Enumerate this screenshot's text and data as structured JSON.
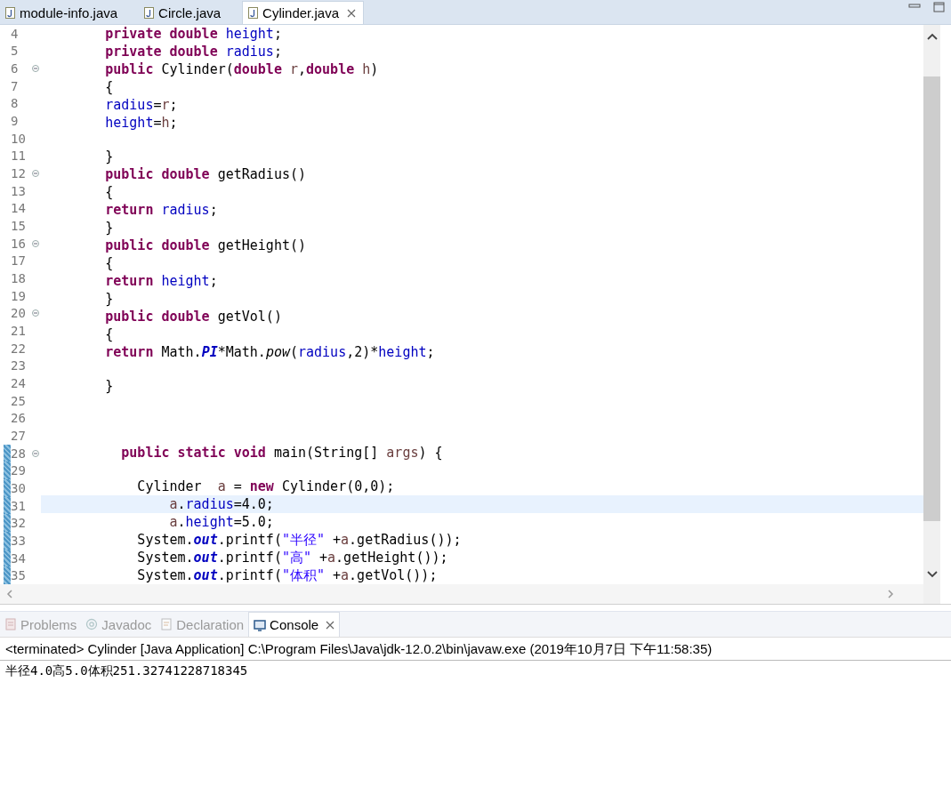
{
  "editor_tabs": [
    {
      "label": "module-info.java",
      "selected": false
    },
    {
      "label": "Circle.java",
      "selected": false
    },
    {
      "label": "Cylinder.java",
      "selected": true,
      "closable": true
    }
  ],
  "code_lines": [
    {
      "number": "4",
      "tokens": [
        {
          "kind": "keyword",
          "text": "        private double "
        },
        {
          "kind": "field",
          "text": "height"
        },
        {
          "kind": "plain",
          "text": ";"
        }
      ]
    },
    {
      "number": "5",
      "tokens": [
        {
          "kind": "keyword",
          "text": "        private double "
        },
        {
          "kind": "field",
          "text": "radius"
        },
        {
          "kind": "plain",
          "text": ";"
        }
      ]
    },
    {
      "number": "6",
      "fold": true,
      "tokens": [
        {
          "kind": "keyword",
          "text": "        public"
        },
        {
          "kind": "plain",
          "text": " Cylinder("
        },
        {
          "kind": "keyword",
          "text": "double "
        },
        {
          "kind": "param",
          "text": "r"
        },
        {
          "kind": "plain",
          "text": ","
        },
        {
          "kind": "keyword",
          "text": "double "
        },
        {
          "kind": "param",
          "text": "h"
        },
        {
          "kind": "plain",
          "text": ")"
        }
      ]
    },
    {
      "number": "7",
      "tokens": [
        {
          "kind": "plain",
          "text": "        {"
        }
      ]
    },
    {
      "number": "8",
      "tokens": [
        {
          "kind": "field",
          "text": "        radius"
        },
        {
          "kind": "plain",
          "text": "="
        },
        {
          "kind": "param",
          "text": "r"
        },
        {
          "kind": "plain",
          "text": ";"
        }
      ]
    },
    {
      "number": "9",
      "tokens": [
        {
          "kind": "field",
          "text": "        height"
        },
        {
          "kind": "plain",
          "text": "="
        },
        {
          "kind": "param",
          "text": "h"
        },
        {
          "kind": "plain",
          "text": ";"
        }
      ]
    },
    {
      "number": "10"
    },
    {
      "number": "11",
      "tokens": [
        {
          "kind": "plain",
          "text": "        }"
        }
      ]
    },
    {
      "number": "12",
      "fold": true,
      "tokens": [
        {
          "kind": "keyword",
          "text": "        public double"
        },
        {
          "kind": "plain",
          "text": " getRadius()"
        }
      ]
    },
    {
      "number": "13",
      "tokens": [
        {
          "kind": "plain",
          "text": "        {"
        }
      ]
    },
    {
      "number": "14",
      "tokens": [
        {
          "kind": "keyword",
          "text": "        return "
        },
        {
          "kind": "field",
          "text": "radius"
        },
        {
          "kind": "plain",
          "text": ";"
        }
      ]
    },
    {
      "number": "15",
      "tokens": [
        {
          "kind": "plain",
          "text": "        }"
        }
      ]
    },
    {
      "number": "16",
      "fold": true,
      "tokens": [
        {
          "kind": "keyword",
          "text": "        public double"
        },
        {
          "kind": "plain",
          "text": " getHeight()"
        }
      ]
    },
    {
      "number": "17",
      "tokens": [
        {
          "kind": "plain",
          "text": "        {"
        }
      ]
    },
    {
      "number": "18",
      "tokens": [
        {
          "kind": "keyword",
          "text": "        return "
        },
        {
          "kind": "field",
          "text": "height"
        },
        {
          "kind": "plain",
          "text": ";"
        }
      ]
    },
    {
      "number": "19",
      "tokens": [
        {
          "kind": "plain",
          "text": "        }"
        }
      ]
    },
    {
      "number": "20",
      "fold": true,
      "tokens": [
        {
          "kind": "keyword",
          "text": "        public double"
        },
        {
          "kind": "plain",
          "text": " getVol()"
        }
      ]
    },
    {
      "number": "21",
      "tokens": [
        {
          "kind": "plain",
          "text": "        {"
        }
      ]
    },
    {
      "number": "22",
      "tokens": [
        {
          "kind": "keyword",
          "text": "        return"
        },
        {
          "kind": "plain",
          "text": " Math."
        },
        {
          "kind": "static",
          "text": "PI"
        },
        {
          "kind": "plain",
          "text": "*Math."
        },
        {
          "kind": "method",
          "text": "pow"
        },
        {
          "kind": "plain",
          "text": "("
        },
        {
          "kind": "field",
          "text": "radius"
        },
        {
          "kind": "plain",
          "text": ",2)*"
        },
        {
          "kind": "field",
          "text": "height"
        },
        {
          "kind": "plain",
          "text": ";"
        }
      ]
    },
    {
      "number": "23"
    },
    {
      "number": "24",
      "tokens": [
        {
          "kind": "plain",
          "text": "        }"
        }
      ]
    },
    {
      "number": "25"
    },
    {
      "number": "26"
    },
    {
      "number": "27"
    },
    {
      "number": "28",
      "fold": true,
      "changed": true,
      "tokens": [
        {
          "kind": "keyword",
          "text": "          public static void"
        },
        {
          "kind": "plain",
          "text": " main(String[] "
        },
        {
          "kind": "param",
          "text": "args"
        },
        {
          "kind": "plain",
          "text": ") {"
        }
      ]
    },
    {
      "number": "29",
      "changed": true
    },
    {
      "number": "30",
      "changed": true,
      "tokens": [
        {
          "kind": "plain",
          "text": "            Cylinder  "
        },
        {
          "kind": "param",
          "text": "a"
        },
        {
          "kind": "plain",
          "text": " = "
        },
        {
          "kind": "keyword",
          "text": "new"
        },
        {
          "kind": "plain",
          "text": " Cylinder(0,0);"
        }
      ]
    },
    {
      "number": "31",
      "changed": true,
      "current": true,
      "tokens": [
        {
          "kind": "param",
          "text": "                a"
        },
        {
          "kind": "plain",
          "text": "."
        },
        {
          "kind": "field",
          "text": "radius"
        },
        {
          "kind": "plain",
          "text": "=4.0;"
        }
      ]
    },
    {
      "number": "32",
      "changed": true,
      "tokens": [
        {
          "kind": "param",
          "text": "                a"
        },
        {
          "kind": "plain",
          "text": "."
        },
        {
          "kind": "field",
          "text": "height"
        },
        {
          "kind": "plain",
          "text": "=5.0;"
        }
      ]
    },
    {
      "number": "33",
      "changed": true,
      "tokens": [
        {
          "kind": "plain",
          "text": "            System."
        },
        {
          "kind": "static",
          "text": "out"
        },
        {
          "kind": "plain",
          "text": ".printf("
        },
        {
          "kind": "string",
          "text": "\"半径\""
        },
        {
          "kind": "plain",
          "text": " +"
        },
        {
          "kind": "param",
          "text": "a"
        },
        {
          "kind": "plain",
          "text": ".getRadius());"
        }
      ]
    },
    {
      "number": "34",
      "changed": true,
      "tokens": [
        {
          "kind": "plain",
          "text": "            System."
        },
        {
          "kind": "static",
          "text": "out"
        },
        {
          "kind": "plain",
          "text": ".printf("
        },
        {
          "kind": "string",
          "text": "\"高\""
        },
        {
          "kind": "plain",
          "text": " +"
        },
        {
          "kind": "param",
          "text": "a"
        },
        {
          "kind": "plain",
          "text": ".getHeight());"
        }
      ]
    },
    {
      "number": "35",
      "changed": true,
      "tokens": [
        {
          "kind": "plain",
          "text": "            System."
        },
        {
          "kind": "static",
          "text": "out"
        },
        {
          "kind": "plain",
          "text": ".printf("
        },
        {
          "kind": "string",
          "text": "\"体积\""
        },
        {
          "kind": "plain",
          "text": " +"
        },
        {
          "kind": "param",
          "text": "a"
        },
        {
          "kind": "plain",
          "text": ".getVol());"
        }
      ]
    }
  ],
  "view_tabs": [
    {
      "label": "Problems",
      "kind": "problems",
      "selected": false
    },
    {
      "label": "Javadoc",
      "kind": "javadoc",
      "selected": false
    },
    {
      "label": "Declaration",
      "kind": "declaration",
      "selected": false
    },
    {
      "label": "Console",
      "kind": "console",
      "selected": true,
      "closable": true
    }
  ],
  "console": {
    "header": "<terminated> Cylinder [Java Application] C:\\Program Files\\Java\\jdk-12.0.2\\bin\\javaw.exe (2019年10月7日 下午11:58:35)",
    "output": [
      "半径4.0高5.0体积251.32741228718345"
    ]
  }
}
